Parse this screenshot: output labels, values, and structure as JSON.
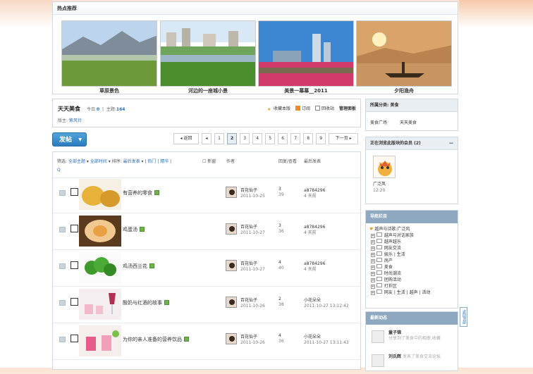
{
  "featured": {
    "title": "热点推荐",
    "items": [
      {
        "caption": "草原景色"
      },
      {
        "caption": "河边的一座城小景"
      },
      {
        "caption": "美景一幕幕__2011"
      },
      {
        "caption": "夕阳渔舟"
      }
    ]
  },
  "forum": {
    "name": "天天美食",
    "today_label": "今日:",
    "today_count": "0",
    "topics_label": "主题:",
    "topics_count": "164",
    "moderator_label": "版主:",
    "moderator": "紫风铃",
    "actions": [
      "收藏本版",
      "订阅",
      "回收站",
      "管理面板"
    ]
  },
  "toolbar": {
    "post_label": "发帖",
    "post_arrow": "▼",
    "pages": [
      "◂ 返回",
      "◂",
      "1",
      "2",
      "3",
      "4",
      "5",
      "6",
      "7",
      "8",
      "9",
      "下一页 ▸"
    ],
    "current_page": "2"
  },
  "list": {
    "filter_label": "筛选:",
    "filter_all": "全部主题",
    "filter_time": "全部时间",
    "sort_label": "排序:",
    "sort_value": "最后发表",
    "hot": "热门",
    "digest": "精华",
    "new_window": "新窗",
    "search_icon_label": "Q",
    "col_author": "作者",
    "col_replies": "回复/查看",
    "col_last": "最后发表",
    "threads": [
      {
        "title": "有营养的零食",
        "author": "百花仙子",
        "date": "2011-10-25",
        "replies": "3",
        "views": "39",
        "last_user": "a8784296",
        "last_time": "4 天前"
      },
      {
        "title": "鸡蛋汤",
        "author": "百花仙子",
        "date": "2011-10-27",
        "replies": "3",
        "views": "36",
        "last_user": "a8784296",
        "last_time": "4 天前"
      },
      {
        "title": "鸡汤西兰花",
        "author": "百花仙子",
        "date": "2011-10-27",
        "replies": "4",
        "views": "40",
        "last_user": "a8784296",
        "last_time": "4 天前"
      },
      {
        "title": "酸奶与红酒的故事",
        "author": "百花仙子",
        "date": "2011-10-26",
        "replies": "2",
        "views": "38",
        "last_user": "小花朵朵",
        "last_time": "2011-10-27 13:12:42"
      },
      {
        "title": "为你的亲人准备的营养饮品",
        "author": "百花仙子",
        "date": "2011-10-26",
        "replies": "4",
        "views": "36",
        "last_user": "小花朵朵",
        "last_time": "2011-10-27 13:11:43"
      }
    ]
  },
  "sidebar": {
    "category_title": "所属分类: 美食",
    "category_links": [
      "美食广场",
      "天天美食"
    ],
    "online_title": "正在浏览此版块的会员 (2)",
    "online_member": "广泛风",
    "online_time": "12:20",
    "nav_title": "导航栏目",
    "nav_root": "越声与诗歌:广泛风",
    "nav_items": [
      "越声与对话家族",
      "越声越乐",
      "网友交流",
      "娱乐 | 生活",
      "房产",
      "美食",
      "时尚潮流",
      "团购活动",
      "打折区",
      "网友 | 生活 | 越声 | 活动"
    ],
    "recent_title": "最新动态",
    "recent": [
      {
        "user": "童子锦",
        "text": "分享到了美食中的相册,收藏"
      },
      {
        "user": "刘氏辉",
        "text": "发表了美食交流论坛"
      }
    ],
    "backtop": "返回顶部"
  }
}
